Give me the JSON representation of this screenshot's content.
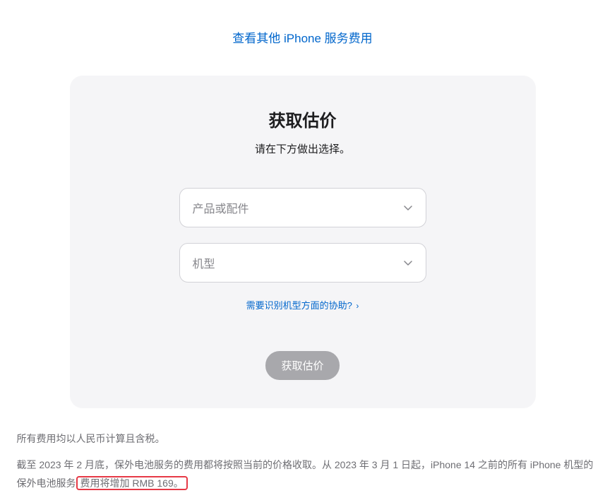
{
  "topLink": {
    "text": "查看其他 iPhone 服务费用"
  },
  "card": {
    "title": "获取估价",
    "subtitle": "请在下方做出选择。",
    "select1": {
      "placeholder": "产品或配件"
    },
    "select2": {
      "placeholder": "机型"
    },
    "helpLink": {
      "text": "需要识别机型方面的协助?",
      "arrow": "›"
    },
    "submitButton": {
      "label": "获取估价"
    }
  },
  "footer": {
    "line1": "所有费用均以人民币计算且含税。",
    "line2_part1": "截至 2023 年 2 月底，保外电池服务的费用都将按照当前的价格收取。从 2023 年 3 月 1 日起，iPhone 14 之前的所有 iPhone 机型的保外电池服务",
    "line2_part2": "费用将增加 RMB 169。"
  }
}
